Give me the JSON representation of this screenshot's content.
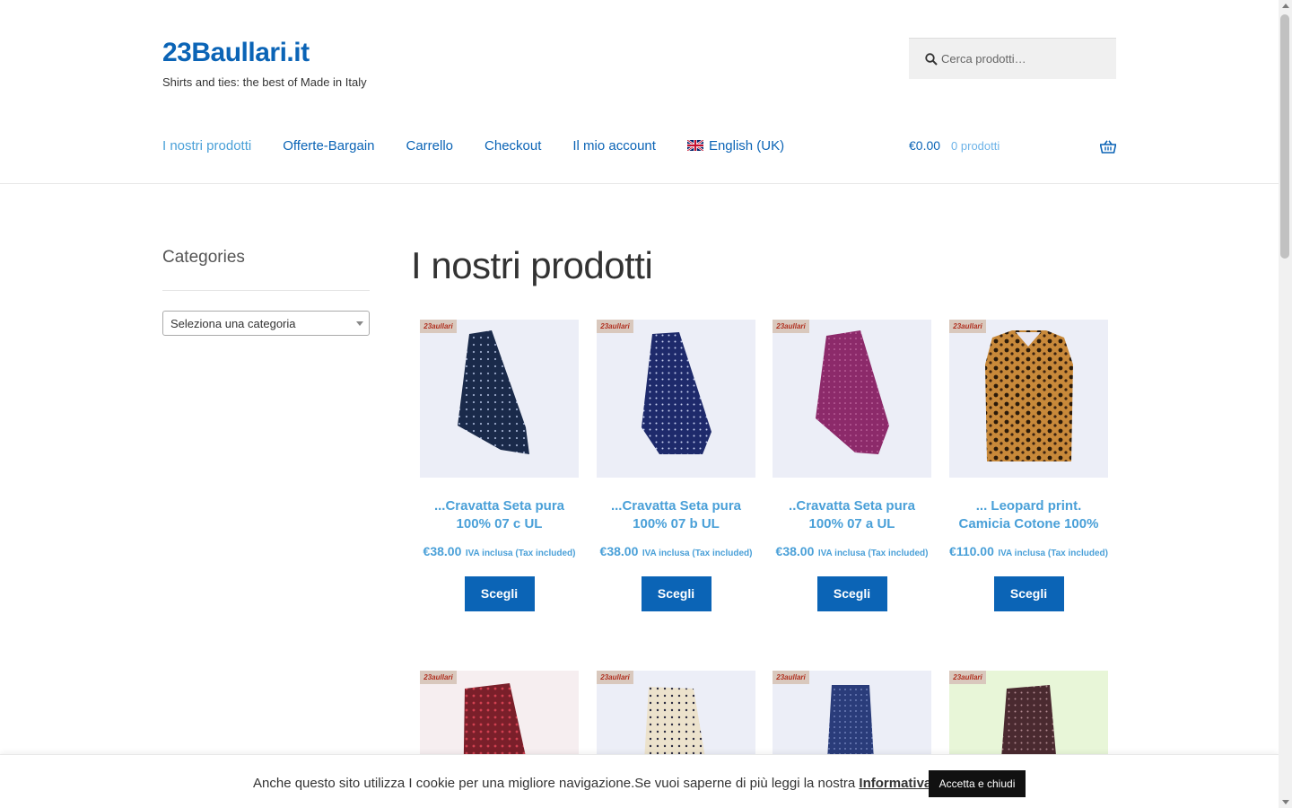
{
  "site": {
    "title": "23Baullari.it",
    "tagline": "Shirts and ties: the best of Made in Italy"
  },
  "search": {
    "placeholder": "Cerca prodotti…"
  },
  "nav": {
    "items": [
      {
        "label": "I nostri prodotti",
        "current": true
      },
      {
        "label": "Offerte-Bargain"
      },
      {
        "label": "Carrello"
      },
      {
        "label": "Checkout"
      },
      {
        "label": "Il mio account"
      },
      {
        "label": "English (UK)",
        "icon": "uk-flag-icon"
      }
    ]
  },
  "cart": {
    "amount": "€0.00",
    "count": "0 prodotti",
    "icon": "basket-icon"
  },
  "sidebar": {
    "title": "Categories",
    "select_value": "Seleziona una categoria"
  },
  "main": {
    "title": "I nostri prodotti"
  },
  "products": [
    {
      "name": "...Cravatta Seta pura 100% 07 c UL",
      "price": "€38.00",
      "tax": "IVA inclusa (Tax included)",
      "button": "Scegli",
      "image": "navy tie with small pattern",
      "bg": "#eceef7",
      "color": "#1a2a4a"
    },
    {
      "name": "...Cravatta Seta pura 100% 07 b UL",
      "price": "€38.00",
      "tax": "IVA inclusa (Tax included)",
      "button": "Scegli",
      "image": "navy tie with dot pattern",
      "bg": "#eceef7",
      "color": "#1e2a6b"
    },
    {
      "name": "..Cravatta Seta pura 100% 07 a UL",
      "price": "€38.00",
      "tax": "IVA inclusa (Tax included)",
      "button": "Scegli",
      "image": "magenta tie",
      "bg": "#eceef7",
      "color": "#8c2a6a"
    },
    {
      "name": "... Leopard print. Camicia Cotone 100%",
      "price": "€110.00",
      "tax": "IVA inclusa (Tax included)",
      "button": "Scegli",
      "image": "leopard print shirt",
      "bg": "#eceef7",
      "color": "#c58a3a"
    },
    {
      "image": "red tie with pattern",
      "bg": "#f6eef0",
      "color": "#7a1f2a"
    },
    {
      "image": "cream tie with dots",
      "bg": "#eceef7",
      "color": "#e8ddc8"
    },
    {
      "image": "blue tie",
      "bg": "#eceef7",
      "color": "#2a3c7a"
    },
    {
      "image": "brown tie",
      "bg": "#e8f6d8",
      "color": "#4a2a30"
    }
  ],
  "cookie": {
    "text": "Anche questo sito utilizza I cookie per una migliore navigazione.Se vuoi saperne di più leggi la nostra",
    "link": "Informativa completa",
    "accept": "Accetta e chiudi"
  }
}
